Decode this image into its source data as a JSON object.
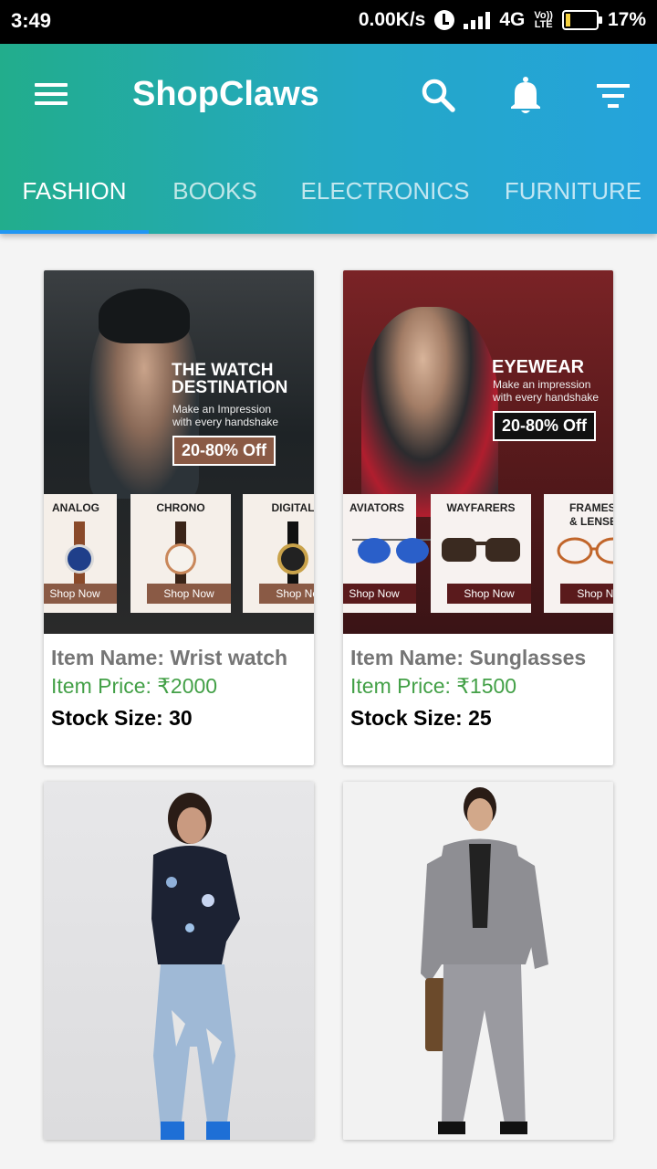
{
  "status_bar": {
    "time": "3:49",
    "net_speed": "0.00K/s",
    "network": "4G",
    "volte_top": "Vo))",
    "volte_bottom": "LTE",
    "battery": "17%",
    "battery_level": 0.17,
    "battery_color": "#f4d03f"
  },
  "app_bar": {
    "title": "ShopClaws",
    "icons": [
      "menu-icon",
      "search-icon",
      "bell-icon",
      "filter-icon"
    ],
    "gradient": [
      "#22ad8c",
      "#25a3dc"
    ]
  },
  "tabs": [
    {
      "label": "FASHION",
      "active": true
    },
    {
      "label": "BOOKS",
      "active": false
    },
    {
      "label": "ELECTRONICS",
      "active": false
    },
    {
      "label": "FURNITURE",
      "active": false
    }
  ],
  "products": [
    {
      "name": "Item Name: Wrist watch",
      "price": "Item Price: ₹2000",
      "stock": "Stock Size: 30",
      "banner": {
        "headline_1": "THE WATCH",
        "headline_2": "DESTINATION",
        "sub_1": "Make an Impression",
        "sub_2": "with every handshake",
        "offer": "20-80% Off",
        "tiles": [
          {
            "label": "ANALOG",
            "button": "Shop Now"
          },
          {
            "label": "CHRONO",
            "button": "Shop Now"
          },
          {
            "label": "DIGITAL",
            "button": "Shop Now"
          }
        ]
      }
    },
    {
      "name": "Item Name: Sunglasses",
      "price": "Item Price: ₹1500",
      "stock": "Stock Size: 25",
      "banner": {
        "headline_1": "EYEWEAR",
        "sub_1": "Make an impression",
        "sub_2": "with every handshake",
        "offer": "20-80% Off",
        "tiles": [
          {
            "label": "AVIATORS",
            "button": "Shop Now"
          },
          {
            "label": "WAYFARERS",
            "button": "Shop Now"
          },
          {
            "label": "FRAMES",
            "label_2": "& LENSES",
            "button": "Shop Now"
          }
        ]
      }
    },
    {
      "image": "woman-in-ripped-jeans"
    },
    {
      "image": "man-in-check-suit"
    }
  ],
  "colors": {
    "price": "#43a047",
    "name": "#757575",
    "tab_indicator": "#2196f3"
  }
}
